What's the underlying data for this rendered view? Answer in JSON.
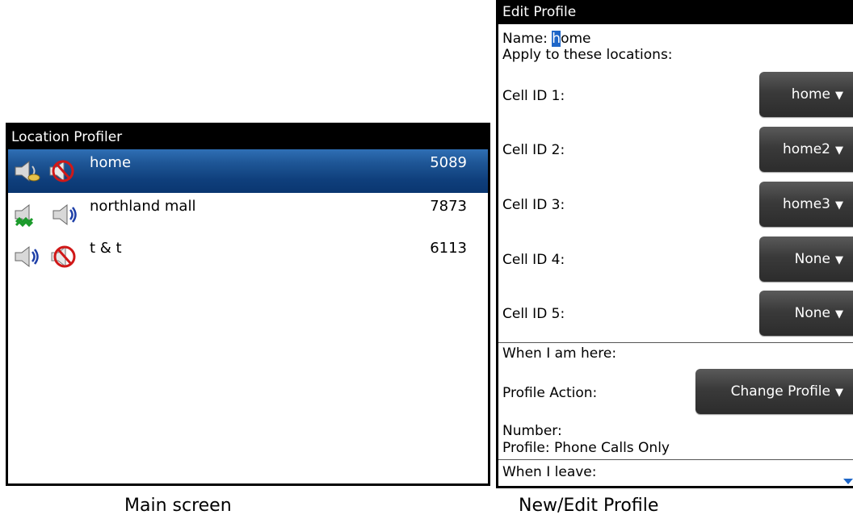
{
  "main_screen": {
    "title": "Location Profiler",
    "rows": [
      {
        "name": "home",
        "number": "5089",
        "selected": true
      },
      {
        "name": "northland mall",
        "number": "7873",
        "selected": false
      },
      {
        "name": "t & t",
        "number": "6113",
        "selected": false
      }
    ],
    "caption": "Main screen"
  },
  "edit_screen": {
    "title": "Edit Profile",
    "name_label": "Name: ",
    "name_cursor_char": "h",
    "name_rest": "ome",
    "apply_label": "Apply to these locations:",
    "cells": [
      {
        "label": "Cell ID 1:",
        "value": "home"
      },
      {
        "label": "Cell ID 2:",
        "value": "home2"
      },
      {
        "label": "Cell ID 3:",
        "value": "home3"
      },
      {
        "label": "Cell ID 4:",
        "value": "None"
      },
      {
        "label": "Cell ID 5:",
        "value": "None"
      }
    ],
    "when_here_label": "When I am here:",
    "profile_action_label": "Profile Action:",
    "profile_action_value": "Change Profile",
    "number_label": "Number:",
    "profile_label": "Profile: Phone Calls Only",
    "when_leave_label": "When I leave:",
    "caption": "New/Edit Profile"
  },
  "colors": {
    "selection_blue": "#1f5797",
    "cursor_blue": "#1e66c8",
    "dropdown_gray": "#3a3a3a"
  },
  "icons": {
    "dropdown_arrow": "▼"
  }
}
